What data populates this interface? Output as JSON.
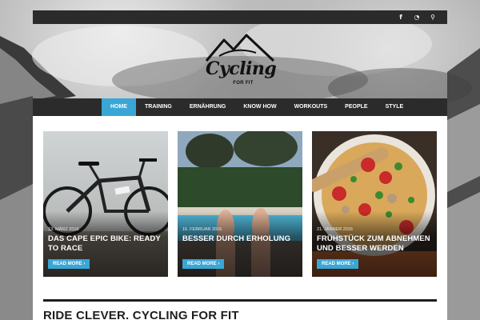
{
  "topbar": {
    "icons": [
      "facebook-icon",
      "rss-icon",
      "search-icon"
    ],
    "facebook_glyph": "f",
    "rss_glyph": "◔",
    "search_glyph": "⚲"
  },
  "logo": {
    "word": "Cycling",
    "sub": "FOR FIT"
  },
  "nav": {
    "items": [
      "HOME",
      "TRAINING",
      "ERNÄHRUNG",
      "KNOW HOW",
      "WORKOUTS",
      "PEOPLE",
      "STYLE"
    ],
    "active": "HOME"
  },
  "cards": [
    {
      "date": "13. MÄRZ 2016",
      "title": "DAS CAPE EPIC BIKE: READY TO RACE",
      "button": "READ MORE ›"
    },
    {
      "date": "15. FEBRUAR 2016",
      "title": "BESSER DURCH ERHOLUNG",
      "button": "READ MORE ›"
    },
    {
      "date": "21. JÄNNER 2016",
      "title": "FRÜHSTÜCK ZUM ABNEHMEN UND BESSER WERDEN",
      "button": "READ MORE ›"
    }
  ],
  "section": {
    "heading": "RIDE CLEVER. CYCLING FOR FIT"
  },
  "colors": {
    "accent": "#39a6d6",
    "bar": "#2b2b2b"
  }
}
